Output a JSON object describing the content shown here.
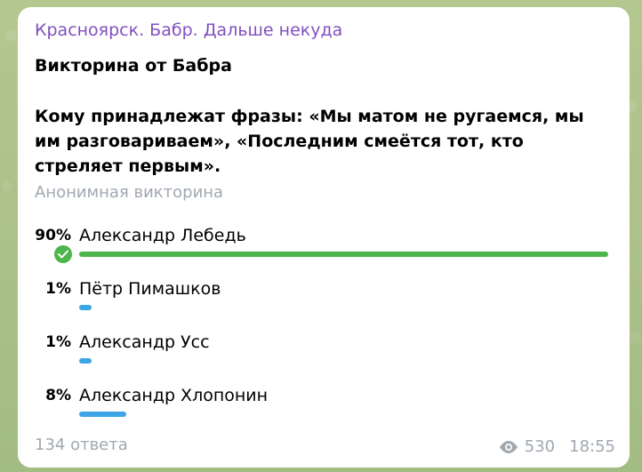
{
  "message": {
    "channel_name": "Красноярск. Бабр. Дальше некуда",
    "title": "Викторина от Бабра",
    "question": "Кому принадлежат фразы: «Мы матом не ругаемся, мы им разговариваем», «Последним смеётся тот, кто стреляет первым».",
    "quiz_type": "Анонимная викторина",
    "options": [
      {
        "percent": "90%",
        "label": "Александр Лебедь",
        "share": 0.9,
        "correct": true
      },
      {
        "percent": "1%",
        "label": "Пётр Пимашков",
        "share": 0.01,
        "correct": false
      },
      {
        "percent": "1%",
        "label": "Александр Усс",
        "share": 0.01,
        "correct": false
      },
      {
        "percent": "8%",
        "label": "Александр Хлопонин",
        "share": 0.08,
        "correct": false
      }
    ],
    "answers_count": "134 ответа",
    "views": "530",
    "time": "18:55"
  },
  "colors": {
    "channel_name": "#8250bf",
    "correct_bar": "#4cb54b",
    "bar": "#3ca5e6",
    "meta_text": "#a0a8b0"
  },
  "icons": {
    "correct_mark": "check-circle-icon",
    "views": "eye-icon"
  }
}
